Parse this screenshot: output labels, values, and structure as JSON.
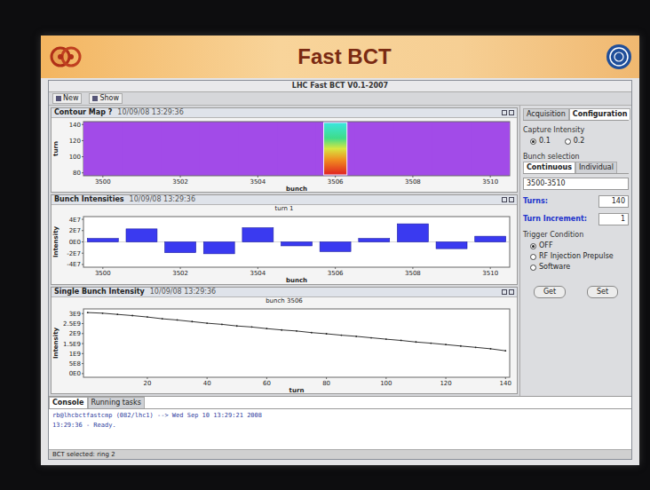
{
  "slide": {
    "title": "Fast BCT"
  },
  "window": {
    "title": "LHC Fast BCT V0.1-2007"
  },
  "toolbar": [
    {
      "label": "New"
    },
    {
      "label": "Show"
    }
  ],
  "panels": [
    {
      "kind": "heatmap",
      "title": "Contour Map ?",
      "time": "10/09/08 13:29:36",
      "x_title": "bunch",
      "y_title": "turn",
      "x_ticks": [
        "3500",
        "3502",
        "3504",
        "3506",
        "3508",
        "3510"
      ],
      "y_ticks": [
        "140",
        "120",
        "100",
        "80"
      ],
      "bunches": [
        3500,
        3501,
        3502,
        3503,
        3504,
        3505,
        3506,
        3507,
        3508,
        3509,
        3510
      ],
      "values": [
        0,
        0,
        0,
        0,
        0,
        0,
        1,
        0,
        0,
        0,
        0
      ]
    },
    {
      "kind": "bars",
      "title": "Bunch Intensities",
      "time": "10/09/08 13:29:36",
      "subtitle": "turn 1",
      "x_title": "bunch",
      "y_title": "Intensity",
      "x_ticks": [
        "3500",
        "3502",
        "3504",
        "3506",
        "3508",
        "3510"
      ],
      "y_ticks": [
        "4E7",
        "2E7",
        "0E0",
        "-2E7",
        "-4E7"
      ],
      "bunches": [
        3500,
        3501,
        3502,
        3503,
        3504,
        3505,
        3506,
        3507,
        3508,
        3509,
        3510
      ],
      "values": [
        6000000,
        23000000,
        -19000000,
        -21000000,
        25000000,
        -7000000,
        -17000000,
        6000000,
        32000000,
        -12000000,
        10000000
      ]
    },
    {
      "kind": "line",
      "title": "Single Bunch Intensity",
      "time": "10/09/08 13:29:36",
      "subtitle": "bunch 3506",
      "x_title": "turn",
      "y_title": "Intensity",
      "x_ticks": [
        "20",
        "40",
        "60",
        "80",
        "100",
        "120",
        "140"
      ],
      "y_ticks": [
        "3E9",
        "2.5E9",
        "2E9",
        "1.5E9",
        "1E9",
        "5E8",
        "0E0"
      ],
      "turns": [
        0,
        5,
        10,
        15,
        20,
        25,
        30,
        35,
        40,
        45,
        50,
        55,
        60,
        65,
        70,
        75,
        80,
        85,
        90,
        95,
        100,
        105,
        110,
        115,
        120,
        125,
        130,
        135,
        140
      ],
      "values": [
        3050000000.0,
        3020000000.0,
        2960000000.0,
        2900000000.0,
        2830000000.0,
        2740000000.0,
        2680000000.0,
        2600000000.0,
        2520000000.0,
        2460000000.0,
        2380000000.0,
        2330000000.0,
        2250000000.0,
        2180000000.0,
        2130000000.0,
        2050000000.0,
        1990000000.0,
        1920000000.0,
        1860000000.0,
        1790000000.0,
        1720000000.0,
        1660000000.0,
        1580000000.0,
        1520000000.0,
        1450000000.0,
        1380000000.0,
        1310000000.0,
        1240000000.0,
        1140000000.0
      ]
    }
  ],
  "config": {
    "tabs": [
      {
        "label": "Acquisition",
        "selected": false
      },
      {
        "label": "Configuration",
        "selected": true
      }
    ],
    "capture": {
      "label": "Capture Intensity",
      "options": [
        {
          "label": "0.1",
          "selected": true
        },
        {
          "label": "0.2",
          "selected": false
        }
      ]
    },
    "bunch_selection": {
      "label": "Bunch selection",
      "tabs": [
        {
          "label": "Continuous",
          "selected": true
        },
        {
          "label": "Individual",
          "selected": false
        }
      ],
      "value": "3500-3510"
    },
    "fields": [
      {
        "label": "Turns:",
        "value": "140"
      },
      {
        "label": "Turn Increment:",
        "value": "1"
      }
    ],
    "trigger": {
      "label": "Trigger Condition",
      "options": [
        {
          "label": "OFF",
          "selected": true
        },
        {
          "label": "RF Injection Prepulse",
          "selected": false
        },
        {
          "label": "Software",
          "selected": false
        }
      ]
    },
    "buttons": [
      "Get",
      "Set"
    ]
  },
  "console": {
    "tabs": [
      {
        "label": "Console",
        "selected": true
      },
      {
        "label": "Running tasks",
        "selected": false
      }
    ],
    "lines": [
      "rb@lhcbctfastcmp (082/lhc1) --> Wed Sep 10 13:29:21 2008",
      "13:29:36 - Ready."
    ]
  },
  "status_bar": "BCT selected: ring 2"
}
